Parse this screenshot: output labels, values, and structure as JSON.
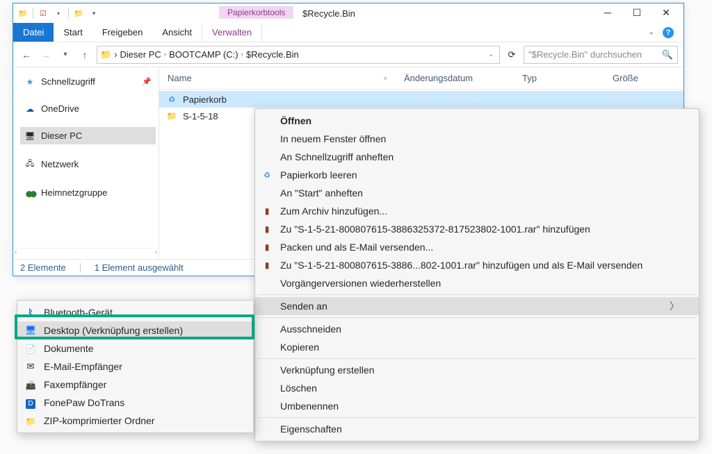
{
  "window": {
    "title": "$Recycle.Bin",
    "tool_tab": "Papierkorbtools"
  },
  "ribbon": {
    "file": "Datei",
    "start": "Start",
    "share": "Freigeben",
    "view": "Ansicht",
    "manage": "Verwalten"
  },
  "address": {
    "crumbs": [
      "Dieser PC",
      "BOOTCAMP (C:)",
      "$Recycle.Bin"
    ],
    "search_placeholder": "\"$Recycle.Bin\" durchsuchen"
  },
  "tree": {
    "quick": "Schnellzugriff",
    "onedrive": "OneDrive",
    "pc": "Dieser PC",
    "network": "Netzwerk",
    "homegroup": "Heimnetzgruppe"
  },
  "columns": {
    "name": "Name",
    "modified": "Änderungsdatum",
    "type": "Typ",
    "size": "Größe"
  },
  "rows": [
    {
      "icon": "bin",
      "name": "Papierkorb",
      "selected": true
    },
    {
      "icon": "folder",
      "name": "S-1-5-18",
      "selected": false
    }
  ],
  "status": {
    "count": "2 Elemente",
    "selected": "1 Element ausgewählt"
  },
  "ctx": {
    "open": "Öffnen",
    "open_new": "In neuem Fenster öffnen",
    "pin_quick": "An Schnellzugriff anheften",
    "empty_bin": "Papierkorb leeren",
    "pin_start": "An \"Start\" anheften",
    "archive_add": "Zum Archiv hinzufügen...",
    "archive_rar": "Zu \"S-1-5-21-800807615-3886325372-817523802-1001.rar\" hinzufügen",
    "pack_mail": "Packen und als E-Mail versenden...",
    "pack_rar_mail": "Zu \"S-1-5-21-800807615-3886...802-1001.rar\" hinzufügen und als E-Mail versenden",
    "prev_versions": "Vorgängerversionen wiederherstellen",
    "send_to": "Senden an",
    "cut": "Ausschneiden",
    "copy": "Kopieren",
    "shortcut": "Verknüpfung erstellen",
    "delete": "Löschen",
    "rename": "Umbenennen",
    "properties": "Eigenschaften"
  },
  "sendto": {
    "bluetooth": "Bluetooth-Gerät",
    "desktop": "Desktop (Verknüpfung erstellen)",
    "documents": "Dokumente",
    "email": "E-Mail-Empfänger",
    "fax": "Faxempfänger",
    "dotrans": "FonePaw DoTrans",
    "zip": "ZIP-komprimierter Ordner"
  }
}
